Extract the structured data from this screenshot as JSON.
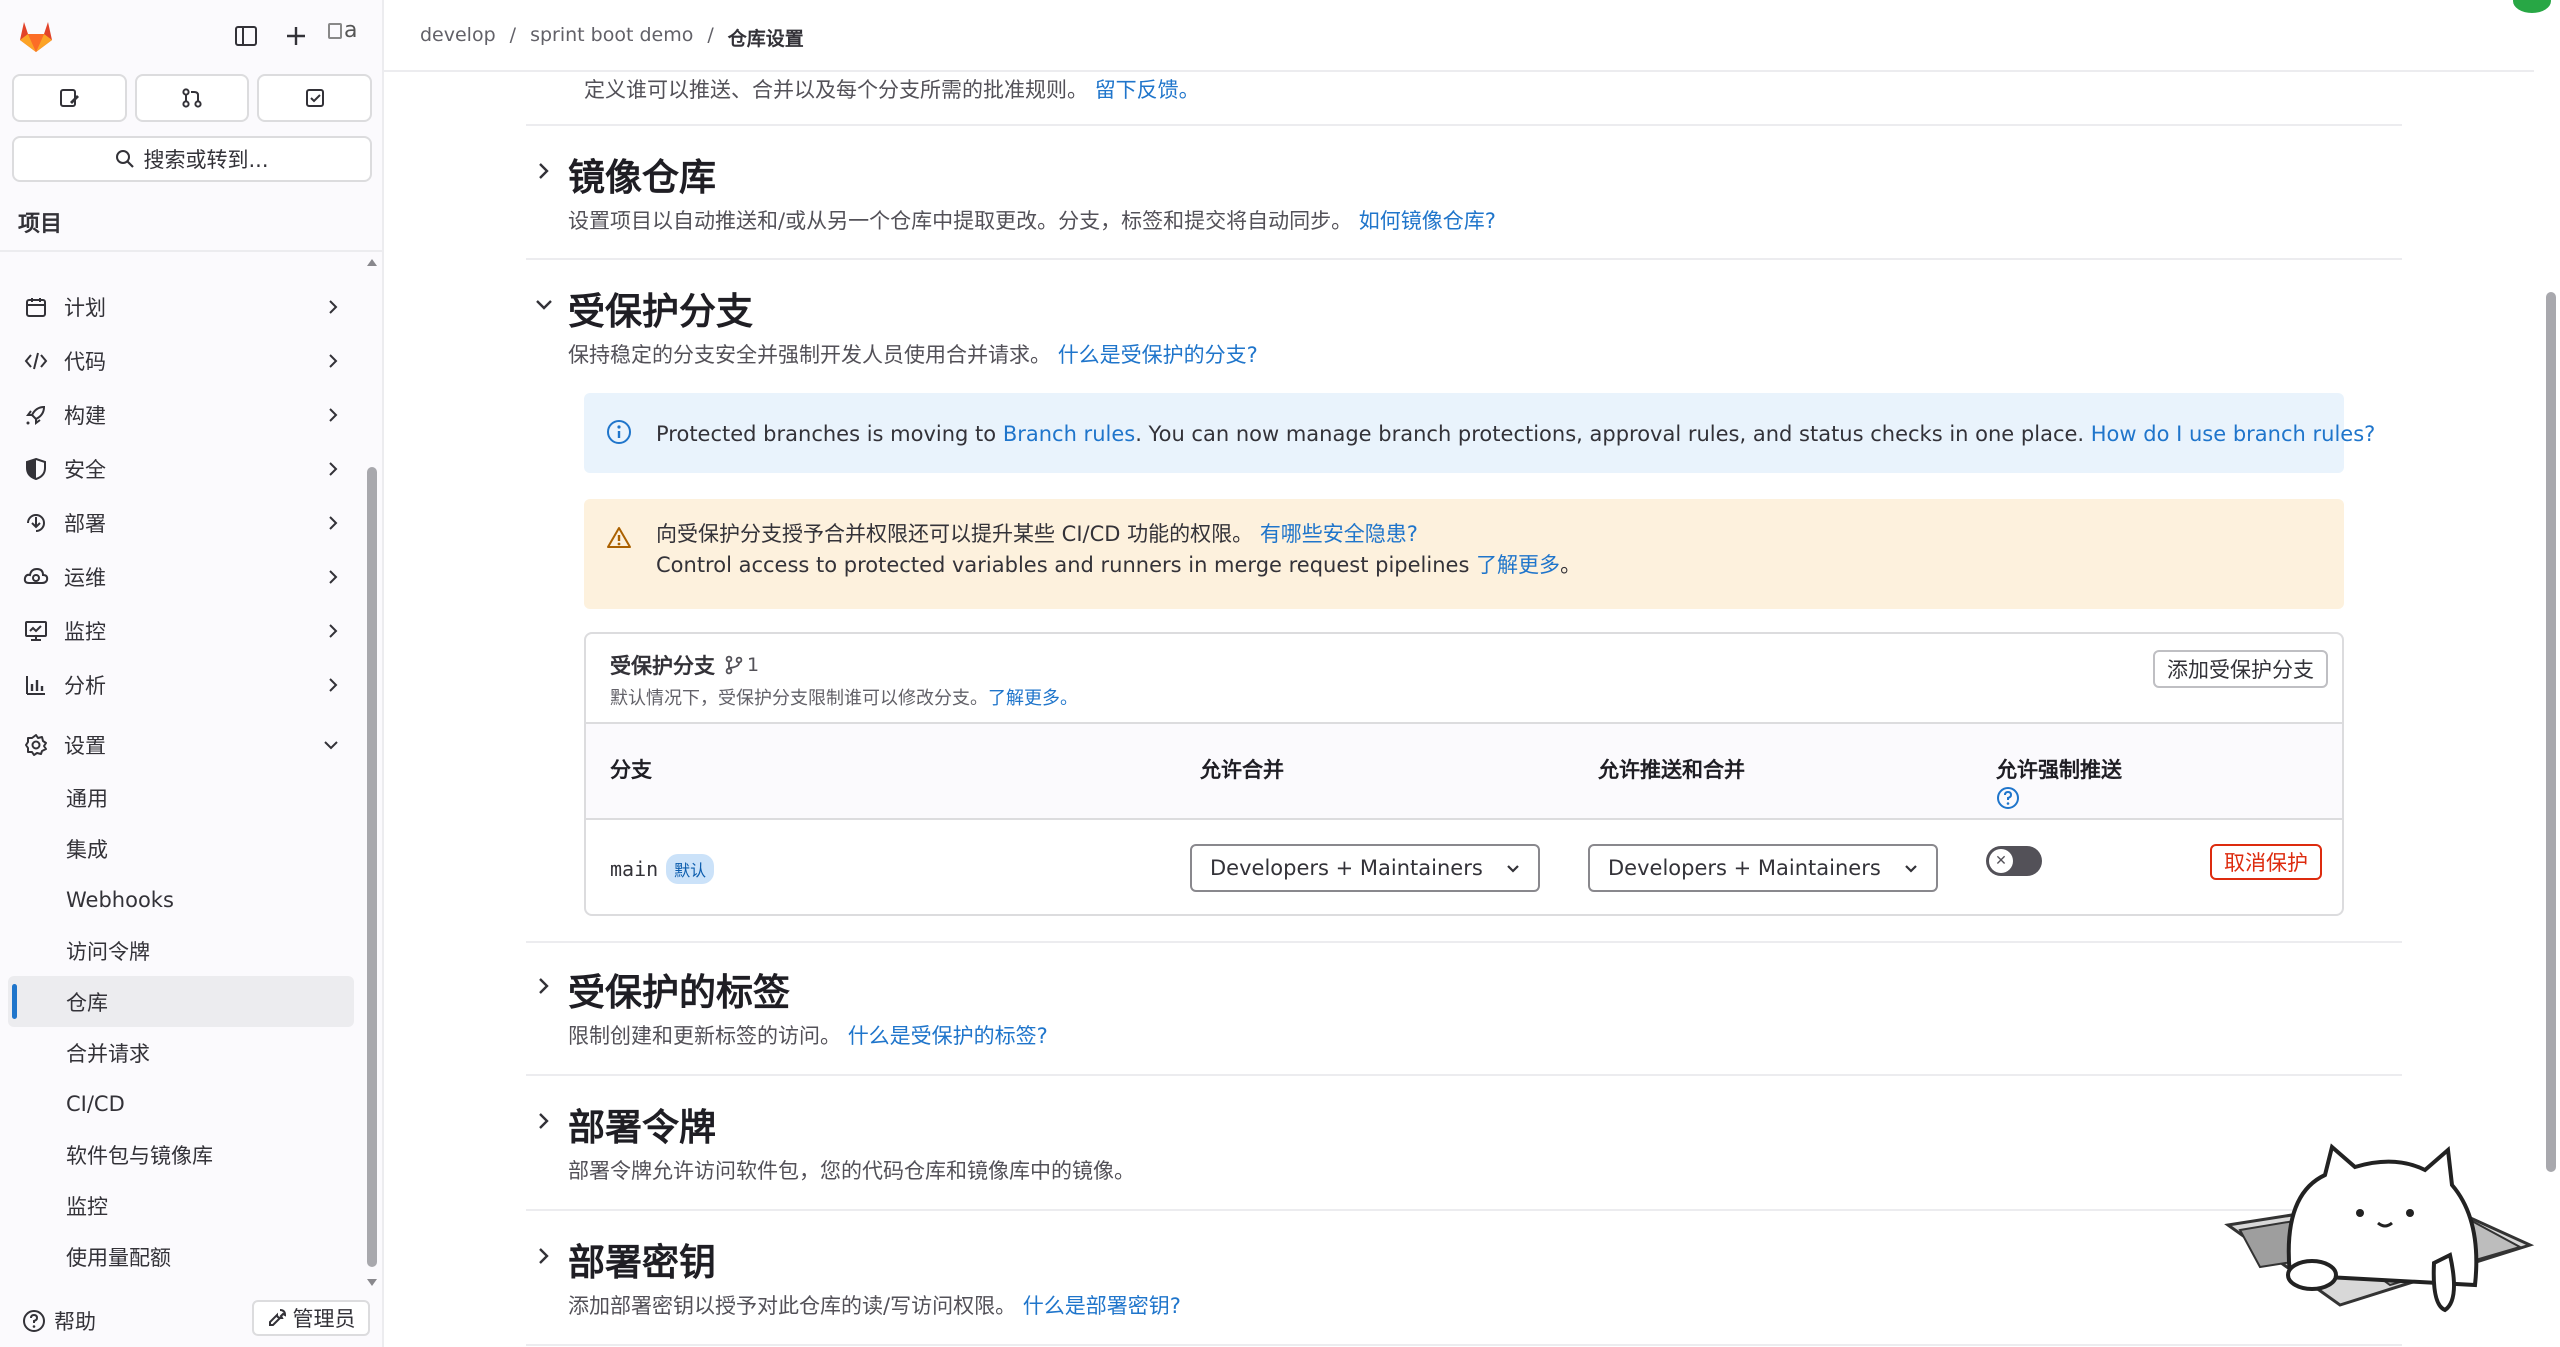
{
  "sidebar": {
    "section_title": "项目",
    "search_label": "搜索或转到...",
    "avatar_alt": "a",
    "nav": [
      {
        "label": "计划",
        "icon": "calendar-icon"
      },
      {
        "label": "代码",
        "icon": "code-icon"
      },
      {
        "label": "构建",
        "icon": "rocket-icon"
      },
      {
        "label": "安全",
        "icon": "shield-icon"
      },
      {
        "label": "部署",
        "icon": "deploy-icon"
      },
      {
        "label": "运维",
        "icon": "cloud-gear-icon"
      },
      {
        "label": "监控",
        "icon": "monitor-icon"
      },
      {
        "label": "分析",
        "icon": "chart-icon"
      },
      {
        "label": "设置",
        "icon": "gear-icon"
      }
    ],
    "settings_sub": [
      "通用",
      "集成",
      "Webhooks",
      "访问令牌",
      "仓库",
      "合并请求",
      "CI/CD",
      "软件包与镜像库",
      "监控",
      "使用量配额"
    ],
    "active_sub": "仓库",
    "help_label": "帮助",
    "admin_label": "管理员"
  },
  "breadcrumb": {
    "items": [
      "develop",
      "sprint boot demo"
    ],
    "current": "仓库设置"
  },
  "intro": {
    "text": "定义谁可以推送、合并以及每个分支所需的批准规则。",
    "link": "留下反馈。"
  },
  "sections": {
    "mirror": {
      "title": "镜像仓库",
      "desc": "设置项目以自动推送和/或从另一个仓库中提取更改。分支，标签和提交将自动同步。",
      "link": "如何镜像仓库?"
    },
    "protected_branches": {
      "title": "受保护分支",
      "desc": "保持稳定的分支安全并强制开发人员使用合并请求。",
      "link": "什么是受保护的分支?"
    },
    "protected_tags": {
      "title": "受保护的标签",
      "desc": "限制创建和更新标签的访问。",
      "link": "什么是受保护的标签?"
    },
    "deploy_tokens": {
      "title": "部署令牌",
      "desc": "部署令牌允许访问软件包，您的代码仓库和镜像库中的镜像。"
    },
    "deploy_keys": {
      "title": "部署密钥",
      "desc": "添加部署密钥以授予对此仓库的读/写访问权限。",
      "link": "什么是部署密钥?"
    }
  },
  "info_alert": {
    "pre": "Protected branches is moving to ",
    "link1": "Branch rules",
    "mid": ". You can now manage branch protections, approval rules, and status checks in one place. ",
    "link2": "How do I use branch rules?"
  },
  "warn_alert": {
    "line1": "向受保护分支授予合并权限还可以提升某些 CI/CD 功能的权限。",
    "link1": "有哪些安全隐患?",
    "line2": "Control access to protected variables and runners in merge request pipelines ",
    "link2": "了解更多",
    "line2_end": "。"
  },
  "card": {
    "title": "受保护分支",
    "count": "1",
    "subtitle": "默认情况下，受保护分支限制谁可以修改分支。",
    "subtitle_link": "了解更多。",
    "add_button": "添加受保护分支",
    "columns": [
      "分支",
      "允许合并",
      "允许推送和合并",
      "允许强制推送"
    ],
    "rows": [
      {
        "branch": "main",
        "badge": "默认",
        "merge": "Developers + Maintainers",
        "push": "Developers + Maintainers",
        "force_push": false,
        "action": "取消保护"
      }
    ]
  },
  "colors": {
    "link": "#1f75cb",
    "danger": "#dd2b0e",
    "info_bg": "#e9f3fc",
    "warn_bg": "#fdf1dd"
  }
}
